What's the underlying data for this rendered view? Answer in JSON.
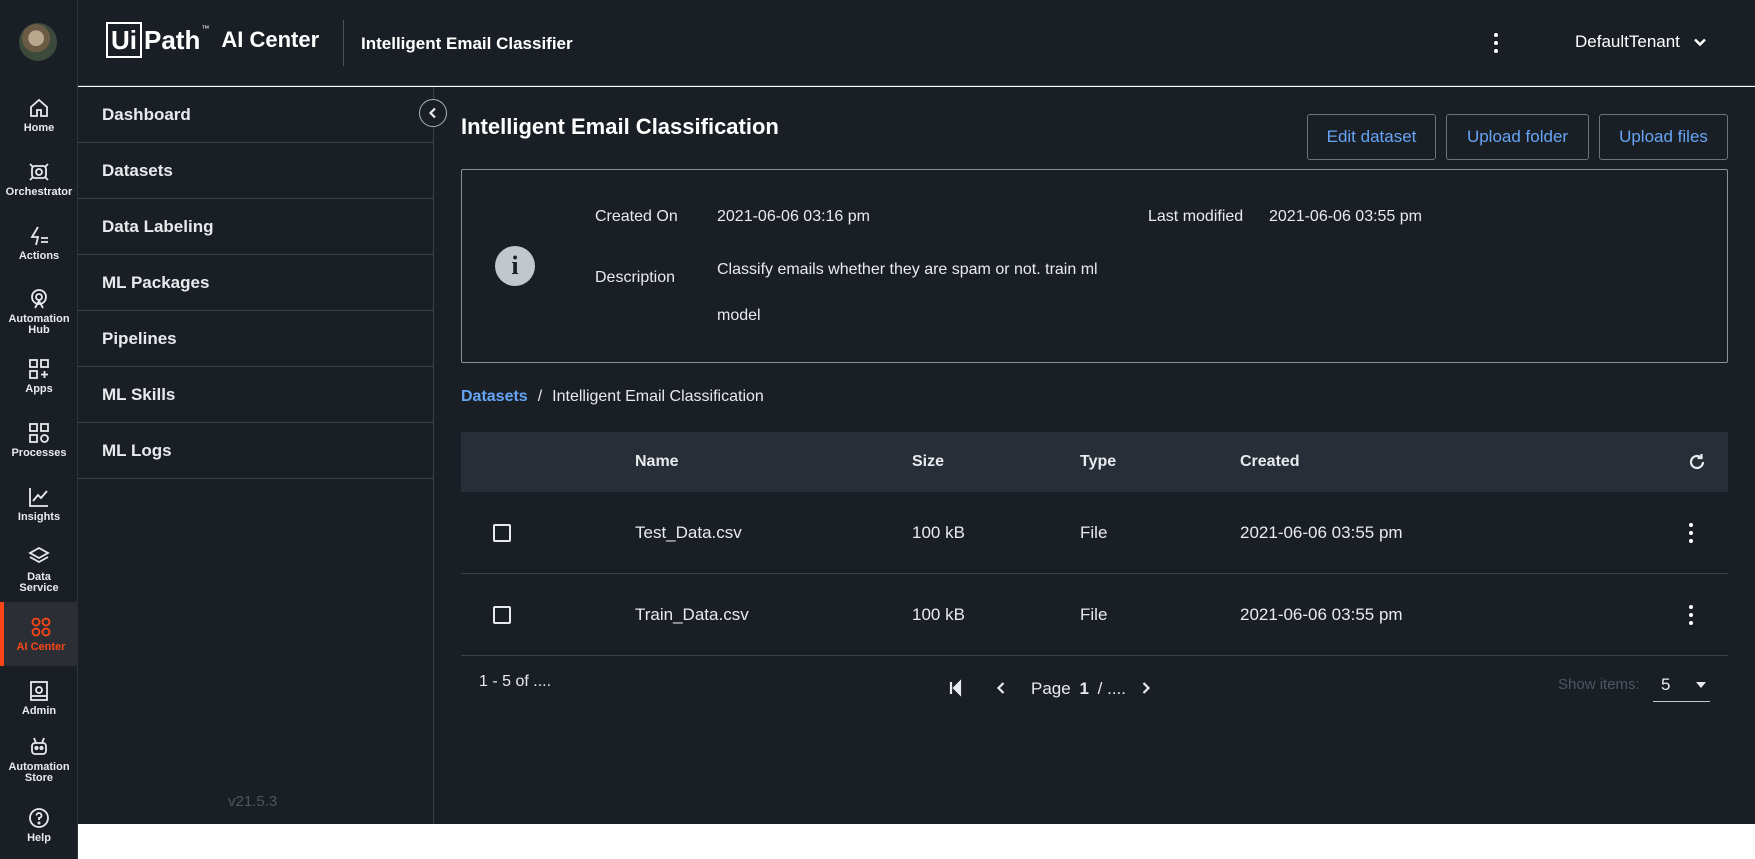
{
  "rail": {
    "items": [
      {
        "label": "Home",
        "icon": "home-icon"
      },
      {
        "label": "Orchestrator",
        "icon": "orchestrator-icon"
      },
      {
        "label": "Actions",
        "icon": "actions-icon"
      },
      {
        "label": "Automation\nHub",
        "icon": "automation-hub-icon"
      },
      {
        "label": "Apps",
        "icon": "apps-icon"
      },
      {
        "label": "Processes",
        "icon": "processes-icon"
      },
      {
        "label": "Insights",
        "icon": "insights-icon"
      },
      {
        "label": "Data\nService",
        "icon": "data-service-icon"
      },
      {
        "label": "AI Center",
        "icon": "ai-center-icon"
      },
      {
        "label": "Admin",
        "icon": "admin-icon"
      },
      {
        "label": "Automation\nStore",
        "icon": "automation-store-icon"
      },
      {
        "label": "Help",
        "icon": "help-icon"
      }
    ],
    "active": "AI Center",
    "accent": "#fa4616"
  },
  "header": {
    "logo_ui": "Ui",
    "logo_path": "Path",
    "logo_tm": "™",
    "product": "AI Center",
    "project": "Intelligent Email Classifier",
    "tenant": "DefaultTenant"
  },
  "subnav": {
    "items": [
      "Dashboard",
      "Datasets",
      "Data Labeling",
      "ML Packages",
      "Pipelines",
      "ML Skills",
      "ML Logs"
    ],
    "version": "v21.5.3"
  },
  "main": {
    "title": "Intelligent Email Classification",
    "buttons": {
      "edit": "Edit dataset",
      "upload_folder": "Upload folder",
      "upload_files": "Upload files"
    },
    "info": {
      "created_on_label": "Created On",
      "created_on": "2021-06-06 03:16 pm",
      "last_modified_label": "Last modified",
      "last_modified": "2021-06-06 03:55 pm",
      "description_label": "Description",
      "description": "Classify emails whether they are spam or not. train ml model"
    },
    "breadcrumb": {
      "root": "Datasets",
      "separator": "/",
      "current": "Intelligent Email Classification"
    },
    "table": {
      "columns": [
        "Name",
        "Size",
        "Type",
        "Created"
      ],
      "rows": [
        {
          "name": "Test_Data.csv",
          "size": "100 kB",
          "type": "File",
          "created": "2021-06-06 03:55 pm"
        },
        {
          "name": "Train_Data.csv",
          "size": "100 kB",
          "type": "File",
          "created": "2021-06-06 03:55 pm"
        }
      ]
    },
    "pager": {
      "range": "1 - 5 of ....",
      "page_label": "Page",
      "page": "1",
      "separator": "/",
      "total": "....",
      "show_items_label": "Show items:",
      "show_items_value": "5"
    }
  },
  "colors": {
    "link": "#66a5f5",
    "background": "#1a1f26",
    "table_header": "#272e37"
  }
}
